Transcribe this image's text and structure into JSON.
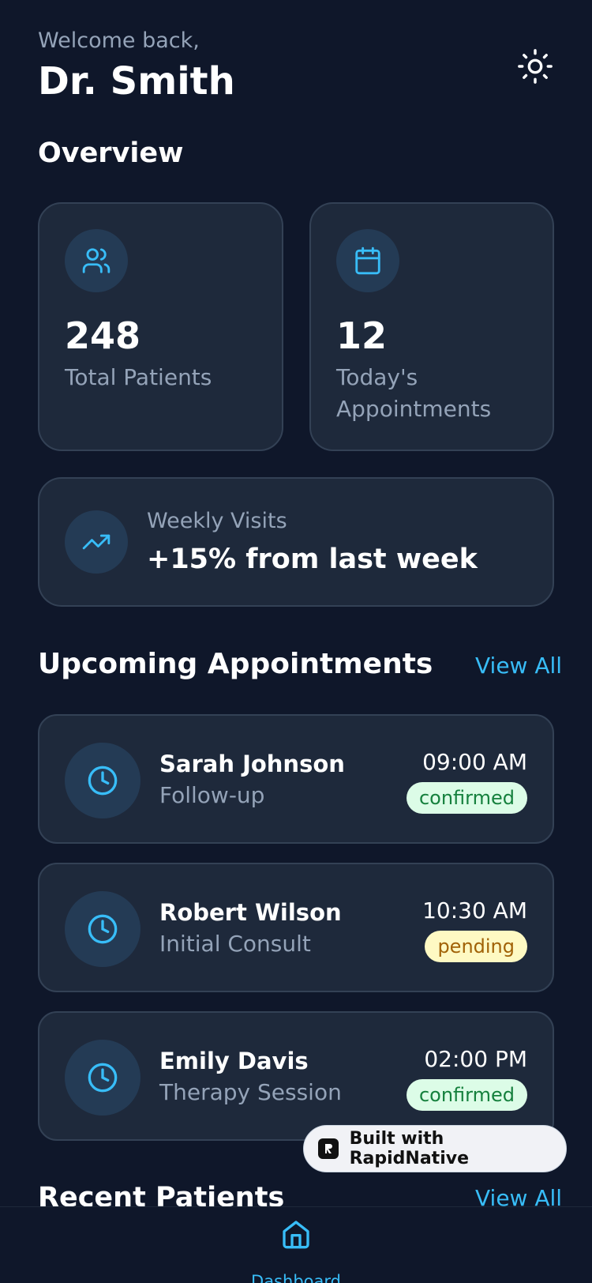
{
  "header": {
    "welcome": "Welcome back,",
    "doctor_name": "Dr. Smith"
  },
  "overview": {
    "title": "Overview",
    "stats": [
      {
        "value": "248",
        "label": "Total Patients",
        "icon": "users-icon"
      },
      {
        "value": "12",
        "label": "Today's Appointments",
        "icon": "calendar-icon"
      }
    ],
    "weekly": {
      "label": "Weekly Visits",
      "value": "+15% from last week",
      "icon": "trending-up-icon"
    }
  },
  "appointments": {
    "title": "Upcoming Appointments",
    "view_all": "View All",
    "items": [
      {
        "name": "Sarah Johnson",
        "type": "Follow-up",
        "time": "09:00 AM",
        "status": "confirmed"
      },
      {
        "name": "Robert Wilson",
        "type": "Initial Consult",
        "time": "10:30 AM",
        "status": "pending"
      },
      {
        "name": "Emily Davis",
        "type": "Therapy Session",
        "time": "02:00 PM",
        "status": "confirmed"
      }
    ]
  },
  "recent_patients": {
    "title": "Recent Patients",
    "view_all": "View All"
  },
  "built_with": {
    "label": "Built with RapidNative"
  },
  "nav": {
    "items": [
      {
        "label": "Dashboard",
        "icon": "home-icon"
      }
    ]
  },
  "colors": {
    "background": "#0f172a",
    "card": "#1e293b",
    "accent": "#38bdf8",
    "confirmed_bg": "#dcfce7",
    "pending_bg": "#fef9c3"
  }
}
